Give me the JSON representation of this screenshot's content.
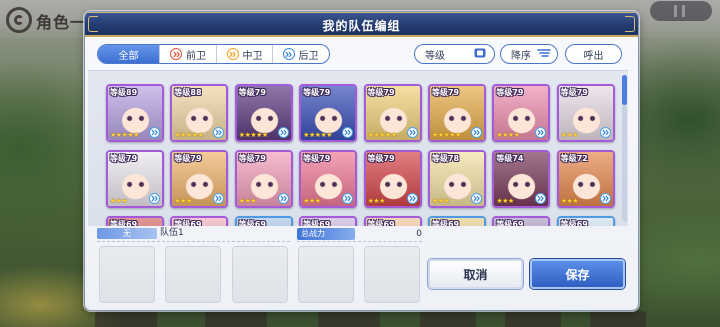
{
  "background": {
    "screen_title": "角色一"
  },
  "dialog": {
    "title": "我的队伍编组",
    "filters": {
      "all": {
        "label": "全部",
        "active": true
      },
      "front": {
        "label": "前卫",
        "active": false,
        "icon": "vanguard-position-icon",
        "color": "#e2553c"
      },
      "middle": {
        "label": "中卫",
        "active": false,
        "icon": "midguard-position-icon",
        "color": "#f0a52a"
      },
      "back": {
        "label": "后卫",
        "active": false,
        "icon": "rearguard-position-icon",
        "color": "#3d8ae0"
      }
    },
    "sort": {
      "field_label": "等级",
      "field_icon": "square-icon",
      "order_label": "降序",
      "order_icon": "sort-descending-icon"
    },
    "call_label": "呼出",
    "roster": {
      "scroll_position": 0,
      "cards": [
        {
          "level": "等级89",
          "stars": 5,
          "frame": "#a45ad9",
          "portrait_color": "#b8a4e4"
        },
        {
          "level": "等级88",
          "stars": 5,
          "frame": "#a45ad9",
          "portrait_color": "#f1d7a6"
        },
        {
          "level": "等级79",
          "stars": 5,
          "frame": "#a45ad9",
          "portrait_color": "#5e3d82"
        },
        {
          "level": "等级79",
          "stars": 5,
          "frame": "#a45ad9",
          "portrait_color": "#3b50b9"
        },
        {
          "level": "等级79",
          "stars": 5,
          "frame": "#a45ad9",
          "portrait_color": "#f1d27c"
        },
        {
          "level": "等级79",
          "stars": 5,
          "frame": "#a45ad9",
          "portrait_color": "#e6ae4c"
        },
        {
          "level": "等级79",
          "stars": 4,
          "frame": "#a45ad9",
          "portrait_color": "#ef8fb1"
        },
        {
          "level": "等级79",
          "stars": 3,
          "frame": "#a45ad9",
          "portrait_color": "#e7dbe5"
        },
        {
          "level": "等级79",
          "stars": 3,
          "frame": "#a45ad9",
          "portrait_color": "#ebe7ee"
        },
        {
          "level": "等级79",
          "stars": 3,
          "frame": "#a45ad9",
          "portrait_color": "#efb56e"
        },
        {
          "level": "等级79",
          "stars": 3,
          "frame": "#a45ad9",
          "portrait_color": "#f2a0b9"
        },
        {
          "level": "等级79",
          "stars": 3,
          "frame": "#a45ad9",
          "portrait_color": "#ef7b98"
        },
        {
          "level": "等级79",
          "stars": 3,
          "frame": "#a45ad9",
          "portrait_color": "#d5474b"
        },
        {
          "level": "等级78",
          "stars": 3,
          "frame": "#a45ad9",
          "portrait_color": "#f2e1a4"
        },
        {
          "level": "等级74",
          "stars": 3,
          "frame": "#a45ad9",
          "portrait_color": "#7b3b5c"
        },
        {
          "level": "等级72",
          "stars": 3,
          "frame": "#a45ad9",
          "portrait_color": "#e6894f"
        },
        {
          "level": "等级69",
          "frame": "#a45ad9",
          "portrait_color": "#d56a6a"
        },
        {
          "level": "等级69",
          "frame": "#a45ad9",
          "portrait_color": "#efb0c1"
        },
        {
          "level": "等级69",
          "frame": "#4f9be3",
          "portrait_color": "#a9c7e7"
        },
        {
          "level": "等级69",
          "frame": "#a45ad9",
          "portrait_color": "#c8b7df"
        },
        {
          "level": "等级69",
          "frame": "#a45ad9",
          "portrait_color": "#efc79f"
        },
        {
          "level": "等级69",
          "frame": "#4f9be3",
          "portrait_color": "#e7cf8f"
        },
        {
          "level": "等级69",
          "frame": "#a45ad9",
          "portrait_color": "#af9fc7"
        },
        {
          "level": "等级69",
          "frame": "#4f9be3",
          "portrait_color": "#cfe0ef"
        }
      ]
    },
    "team": {
      "badge": "无",
      "name": "队伍1",
      "power_label": "总战力",
      "power_value": "0",
      "slots": [
        {
          "empty": true
        },
        {
          "empty": true
        },
        {
          "empty": true
        },
        {
          "empty": true
        },
        {
          "empty": true
        }
      ]
    },
    "buttons": {
      "cancel": "取消",
      "save": "保存"
    }
  }
}
